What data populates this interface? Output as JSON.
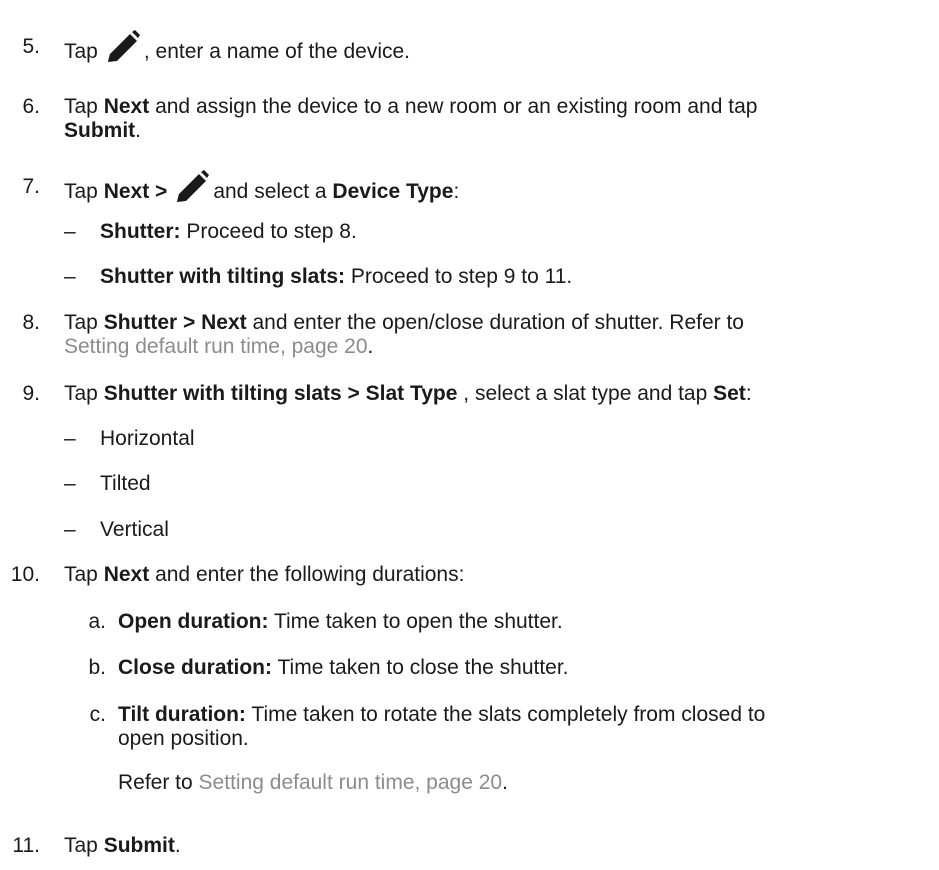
{
  "steps": {
    "s5": {
      "num": "5.",
      "pre": "Tap",
      "post": ", enter a name of the device."
    },
    "s6": {
      "num": "6.",
      "pre": "Tap",
      "bold1": "Next",
      "mid": "and assign the device to a new room or an existing room and tap",
      "bold2": "Submit",
      "end": "."
    },
    "s7": {
      "num": "7.",
      "pre": "Tap",
      "bold1": "Next >",
      "mid": "and select a",
      "bold2": "Device Type",
      "end": ":"
    },
    "s7_sub": [
      {
        "dash": "–",
        "bold": "Shutter:",
        "text": "Proceed to step 8."
      },
      {
        "dash": "–",
        "bold": "Shutter with tilting slats:",
        "text": "Proceed to step 9 to 11."
      }
    ],
    "s8": {
      "num": "8.",
      "pre": "Tap",
      "bold1": "Shutter > Next",
      "mid": "and enter the open/close duration of shutter. Refer to",
      "link": "Setting default run time, page 20",
      "end": "."
    },
    "s9": {
      "num": "9.",
      "pre": "Tap",
      "bold1": "Shutter with tilting slats > Slat Type",
      "mid": ", select a slat type and tap",
      "bold2": "Set",
      "end": ":"
    },
    "s9_sub": [
      {
        "dash": "–",
        "text": "Horizontal"
      },
      {
        "dash": "–",
        "text": "Tilted"
      },
      {
        "dash": "–",
        "text": "Vertical"
      }
    ],
    "s10": {
      "num": "10.",
      "pre": "Tap",
      "bold1": "Next",
      "mid": "and enter the following durations:"
    },
    "s10_sub": [
      {
        "letter": "a.",
        "bold": "Open duration:",
        "text": "Time taken to open the shutter."
      },
      {
        "letter": "b.",
        "bold": "Close duration:",
        "text": "Time taken to close the shutter."
      },
      {
        "letter": "c.",
        "bold": "Tilt duration:",
        "text": "Time taken to rotate the slats completely from closed to",
        "text2": "open position."
      }
    ],
    "s10_refer": {
      "pre": "Refer to",
      "link": "Setting default run time, page 20",
      "end": "."
    },
    "s11": {
      "num": "11.",
      "pre": "Tap",
      "bold1": "Submit",
      "end": "."
    }
  },
  "icons": {
    "edit": "pencil-icon"
  },
  "colors": {
    "text": "#1a1a1a",
    "link": "#8c8c8c"
  }
}
